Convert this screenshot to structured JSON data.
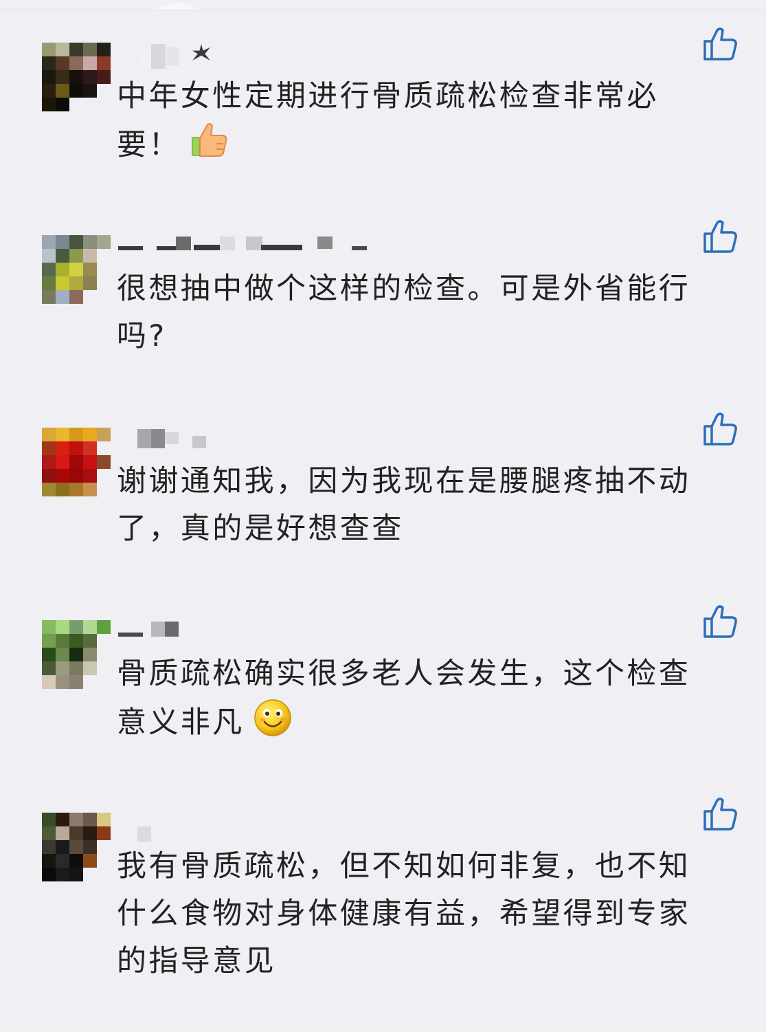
{
  "colors": {
    "background": "#efeff4",
    "text": "#222222",
    "like_icon": "#2c6fb8"
  },
  "comments": [
    {
      "text": "中年女性定期进行骨质疏松检查非常必要！",
      "emoji": "thumbs-up-emoji",
      "avatar": [
        "#9a9a70",
        "#b8b89a",
        "#3a3a2a",
        "#6b6b50",
        "#222018",
        "#2a2818",
        "#5a3828",
        "#8a6a5a",
        "#c8a8a8",
        "#8a3a2a",
        "#1a1a10",
        "#3a2a18",
        "#1a1010",
        "#2a1a1a",
        "#4a1a18",
        "#2a2010",
        "#6a5a18",
        "#100e08",
        "#1a1414",
        "#efeff4",
        "#1a1608",
        "#0e0c06",
        "#efeff4",
        "#efeff4",
        "#efeff4"
      ]
    },
    {
      "text": "很想抽中做个这样的检查。可是外省能行吗?",
      "emoji": "",
      "avatar": [
        "#9aa6b0",
        "#7a8690",
        "#4a5240",
        "#8a9080",
        "#a0a890",
        "#b8c4cc",
        "#4a5a40",
        "#8a9a50",
        "#c8b8a8",
        "#efeff4",
        "#5a6a50",
        "#a8b030",
        "#d0d040",
        "#9a8a50",
        "#efeff4",
        "#6a7a40",
        "#c8c830",
        "#b0a840",
        "#8a8050",
        "#efeff4",
        "#7a7a60",
        "#a0b0c0",
        "#8a6a5a",
        "#efeff4",
        "#efeff4"
      ]
    },
    {
      "text": "谢谢通知我，因为我现在是腰腿疼抽不动了，真的是好想查查",
      "emoji": "",
      "avatar": [
        "#d8a838",
        "#e8b830",
        "#d89818",
        "#e8a820",
        "#c8a058",
        "#a03818",
        "#d82010",
        "#c01010",
        "#d03020",
        "#efeff4",
        "#b01818",
        "#d81818",
        "#a00808",
        "#c81010",
        "#8a4a2a",
        "#901010",
        "#a80808",
        "#980808",
        "#a81010",
        "#efeff4",
        "#a08830",
        "#8a7020",
        "#a87828",
        "#c89050",
        "#efeff4"
      ]
    },
    {
      "text": "骨质疏松确实很多老人会发生，这个检查意义非凡",
      "emoji": "smiley-emoji",
      "avatar": [
        "#88b860",
        "#a8d880",
        "#7a9a70",
        "#b0d890",
        "#60a040",
        "#70a050",
        "#5a7a3a",
        "#3a5a20",
        "#5a6a40",
        "#efeff4",
        "#2a4a1a",
        "#6a8a50",
        "#1a2a10",
        "#8a8a70",
        "#efeff4",
        "#4a5a3a",
        "#9a9a80",
        "#7a7a60",
        "#c8c8b0",
        "#efeff4",
        "#d8c8b8",
        "#9a9080",
        "#8a8070",
        "#efeff4",
        "#efeff4"
      ]
    },
    {
      "text": "我有骨质疏松，但不知如何非复，也不知什么食物对身体健康有益，希望得到专家的指导意见",
      "emoji": "",
      "avatar": [
        "#3a4a2a",
        "#2a1a10",
        "#8a7a6a",
        "#6a5a4a",
        "#d8c880",
        "#4a5a3a",
        "#b8a898",
        "#4a3a2a",
        "#2a1a10",
        "#8a3a1a",
        "#3a3a30",
        "#1a1a18",
        "#5a4a3a",
        "#3a3028",
        "#efeff4",
        "#1a1410",
        "#2a2a2a",
        "#0e0e0e",
        "#8a4a1a",
        "#efeff4",
        "#0a0a0a",
        "#1a1a1a",
        "#141414",
        "#efeff4",
        "#efeff4"
      ]
    }
  ]
}
